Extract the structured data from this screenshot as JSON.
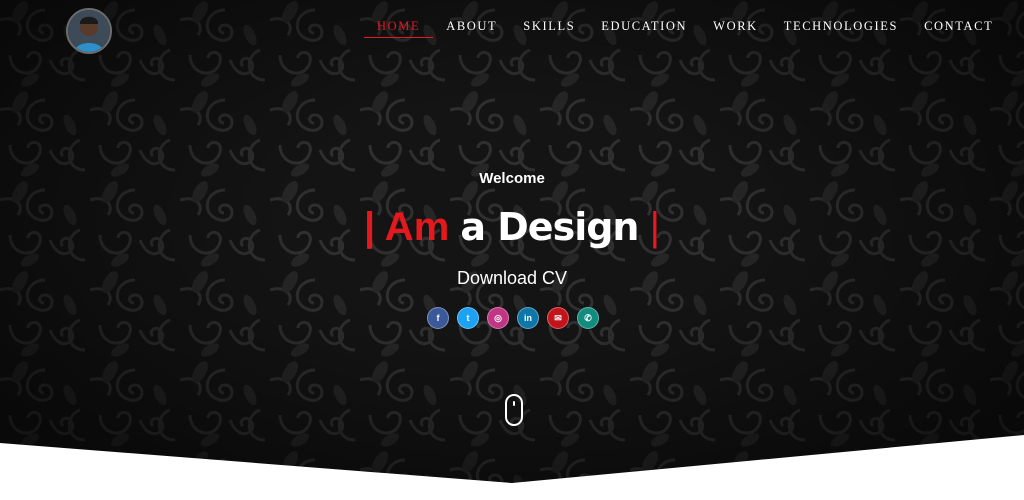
{
  "nav": {
    "items": [
      {
        "label": "HOME",
        "active": true
      },
      {
        "label": "ABOUT",
        "active": false
      },
      {
        "label": "SKILLS",
        "active": false
      },
      {
        "label": "EDUCATION",
        "active": false
      },
      {
        "label": "WORK",
        "active": false
      },
      {
        "label": "TECHNOLOGIES",
        "active": false
      },
      {
        "label": "CONTACT",
        "active": false
      }
    ]
  },
  "hero": {
    "welcome": "Welcome",
    "headline_prefix": "| Am",
    "headline_typed": "a Design",
    "cursor": "|",
    "download_label": "Download CV"
  },
  "socials": [
    {
      "icon": "facebook-icon",
      "glyph": "f",
      "color": "#3b5998"
    },
    {
      "icon": "twitter-icon",
      "glyph": "t",
      "color": "#1da1f2"
    },
    {
      "icon": "instagram-icon",
      "glyph": "◎",
      "color": "#c13584"
    },
    {
      "icon": "linkedin-icon",
      "glyph": "in",
      "color": "#0e76a8"
    },
    {
      "icon": "mail-icon",
      "glyph": "✉",
      "color": "#c4141b"
    },
    {
      "icon": "whatsapp-icon",
      "glyph": "✆",
      "color": "#128c7e"
    }
  ],
  "colors": {
    "accent": "#e5191d",
    "background": "#141414"
  }
}
